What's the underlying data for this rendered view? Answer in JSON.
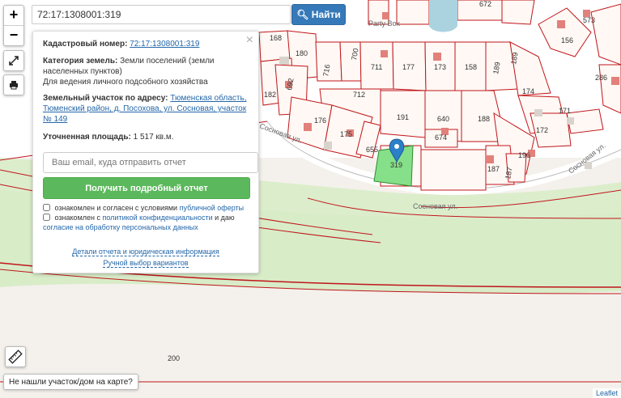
{
  "search": {
    "value": "72:17:1308001:319",
    "button_label": "Найти"
  },
  "zoom": {
    "in": "+",
    "out": "−"
  },
  "panel": {
    "cadastral_label": "Кадастровый номер:",
    "cadastral_value": "72:17:1308001:319",
    "category_label": "Категория земель:",
    "category_value": "Земли поселений (земли населенных пунктов)",
    "usage": "Для ведения личного подсобного хозяйства",
    "address_label": "Земельный участок по адресу:",
    "address_value": "Тюменская область, Тюменский район, д. Посохова, ул. Сосновая, участок № 149",
    "area_label": "Уточненная площадь:",
    "area_value": "1 517 кв.м.",
    "email_placeholder": "Ваш email, куда отправить отчет",
    "report_button": "Получить подробный отчет",
    "agree1_prefix": "ознакомлен и согласен с условиями",
    "agree1_link": "публичной оферты",
    "agree2_prefix": "ознакомлен с",
    "agree2_link1": "политикой конфиденциальности",
    "agree2_mid": "и даю",
    "agree2_link2": "согласие на обработку персональных данных",
    "details_link": "Детали отчета и юридическая информация",
    "manual_link": "Ручной выбор вариантов"
  },
  "map": {
    "parcels": [
      "168",
      "180",
      "182",
      "692",
      "716",
      "700",
      "711",
      "177",
      "173",
      "158",
      "189",
      "189",
      "174",
      "171",
      "172",
      "286",
      "573",
      "156",
      "712",
      "176",
      "175",
      "655",
      "191",
      "640",
      "674",
      "188",
      "196",
      "187",
      "187",
      "319",
      "672",
      "200"
    ],
    "streets": [
      "Сосновая ул.",
      "Сосновая ул.",
      "Сосновая ул."
    ],
    "poi": "Party Box",
    "selected_parcel_color": "#86e08a",
    "boundary_color": "#c0151a"
  },
  "not_found": "Не нашли участок/дом на карте?",
  "attribution": "Leaflet"
}
